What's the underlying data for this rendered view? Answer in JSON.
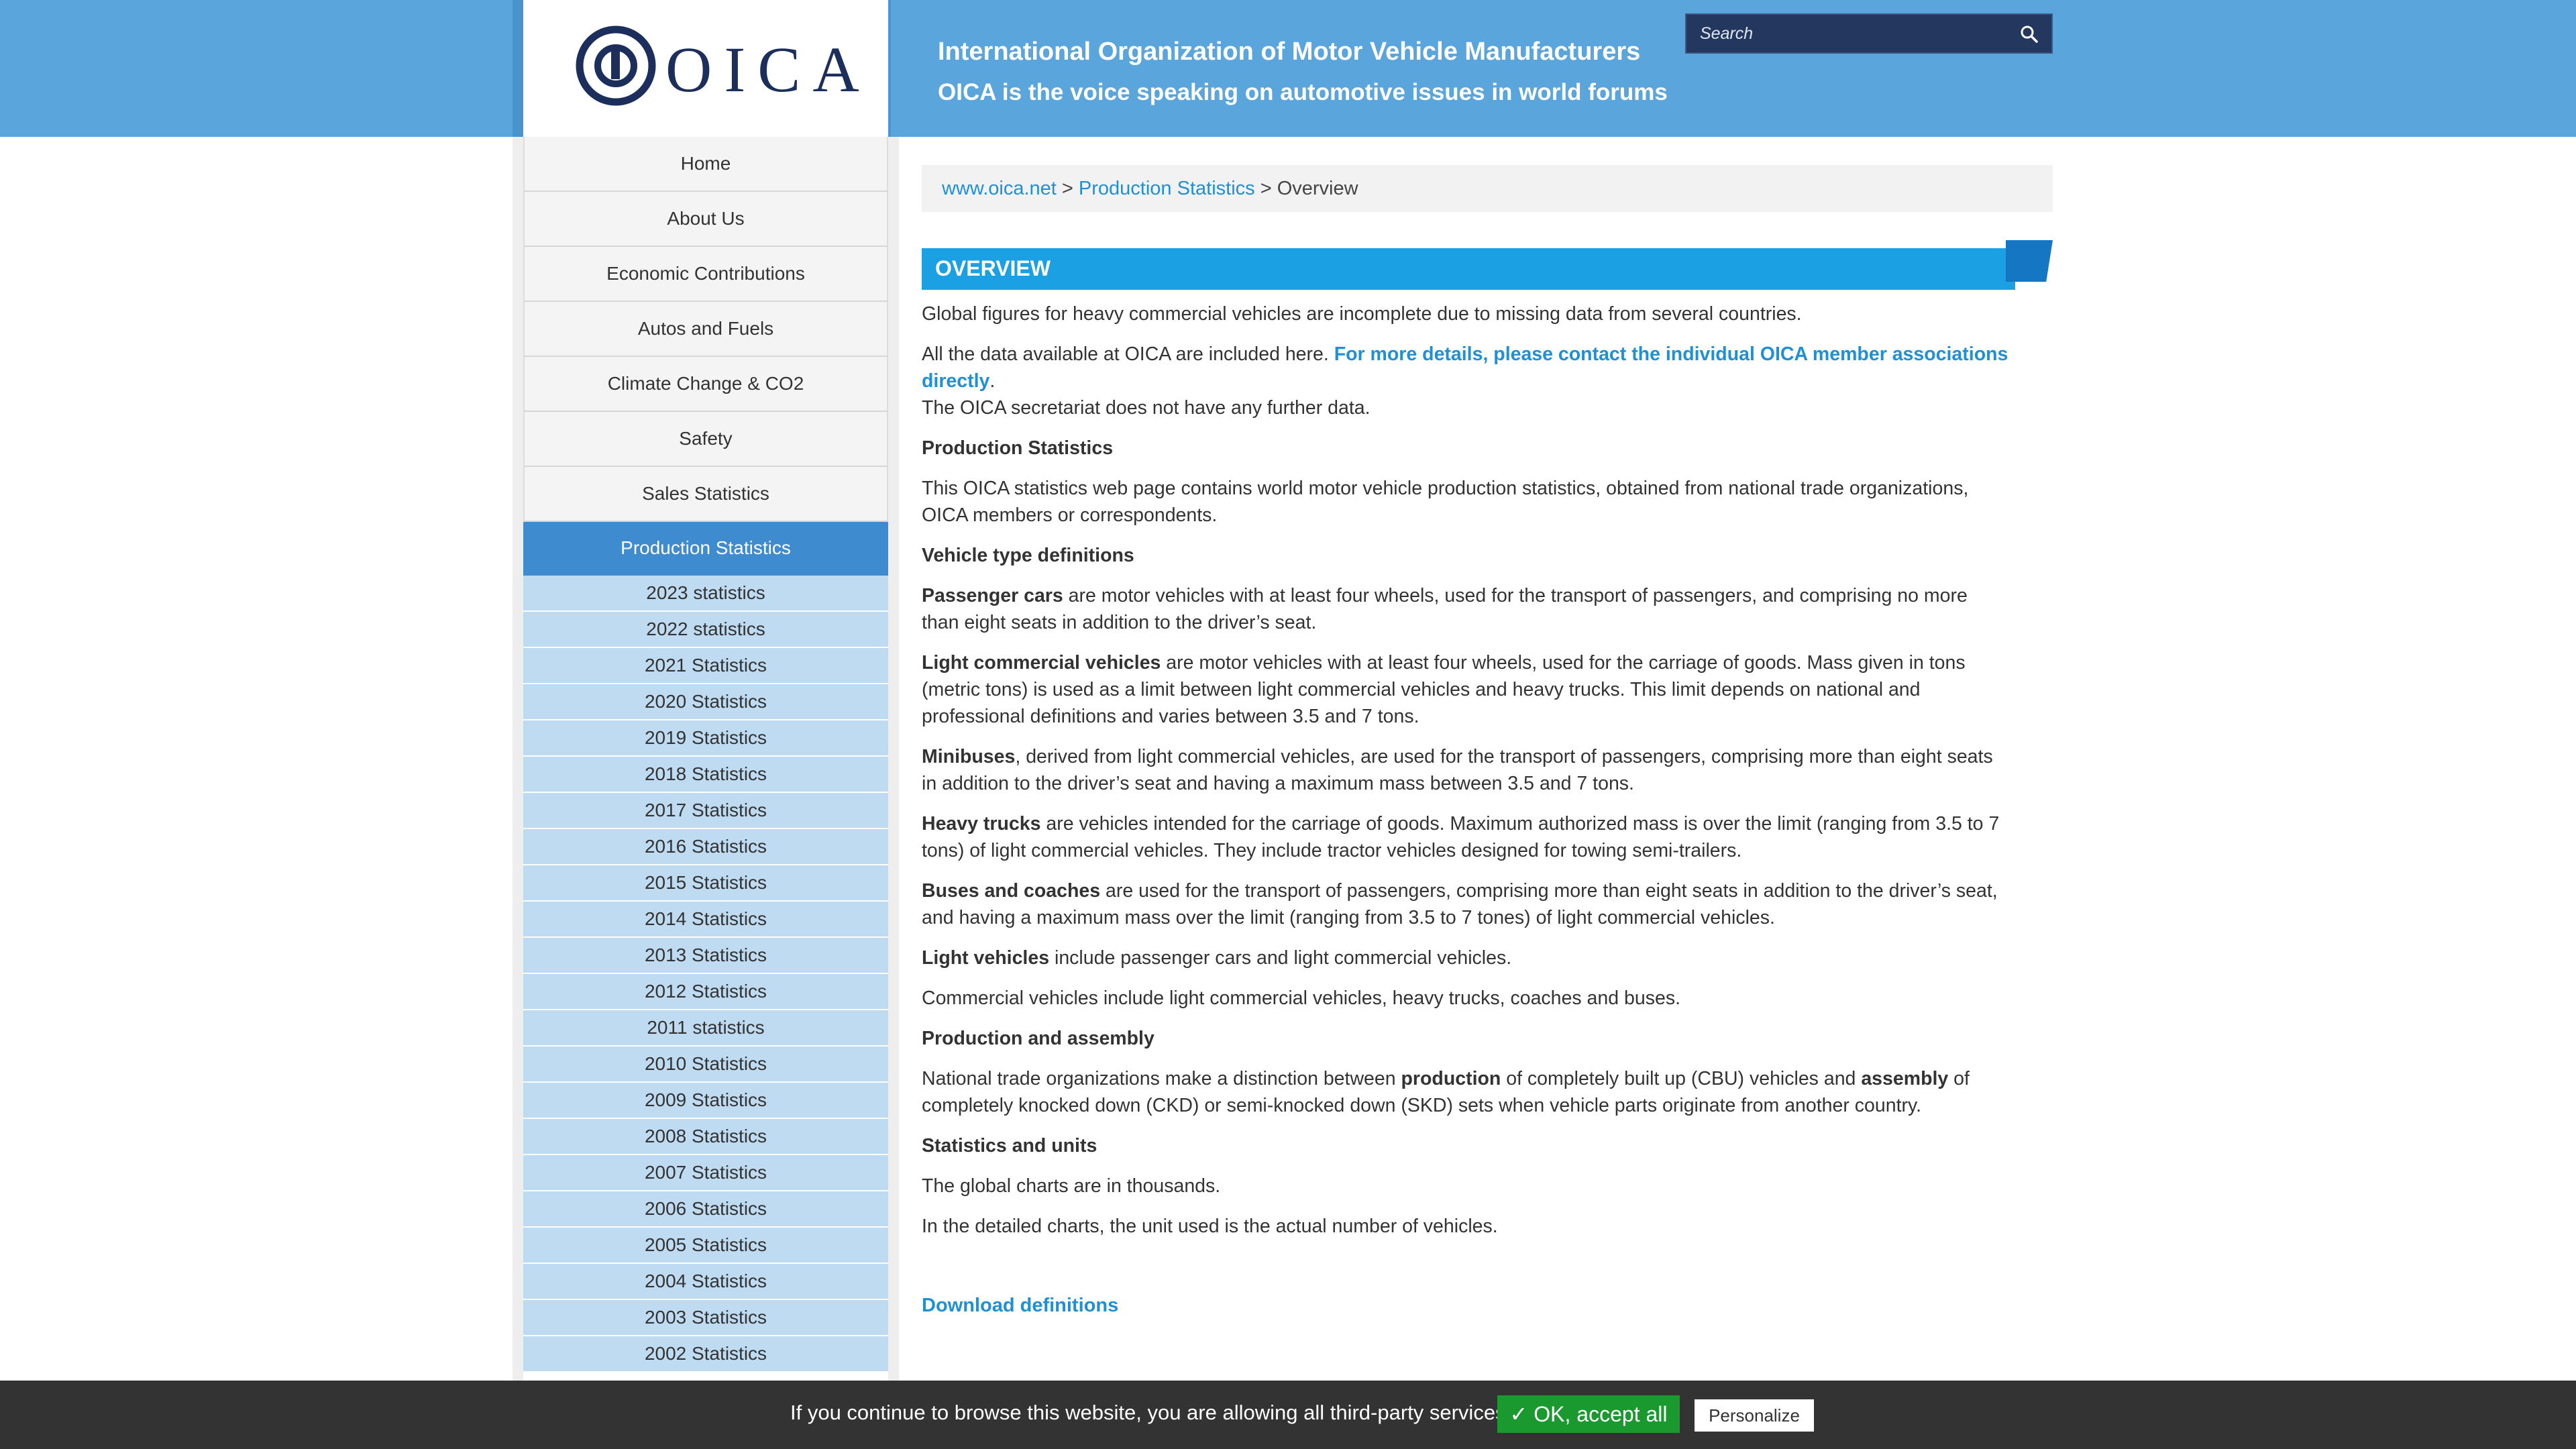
{
  "header": {
    "logo_text": "OICA",
    "title": "International Organization of Motor Vehicle Manufacturers",
    "subtitle": "OICA is the voice speaking on automotive issues in world forums",
    "search_placeholder": "Search",
    "colors": {
      "bar": "#5aa5dc",
      "logo": "#1c2e5c",
      "search_bg": "#24385f"
    }
  },
  "nav": {
    "items": [
      {
        "label": "Home"
      },
      {
        "label": "About Us"
      },
      {
        "label": "Economic Contributions"
      },
      {
        "label": "Autos and Fuels"
      },
      {
        "label": "Climate Change & CO2"
      },
      {
        "label": "Safety"
      },
      {
        "label": "Sales Statistics"
      },
      {
        "label": "Production Statistics",
        "active": true
      }
    ],
    "subitems": [
      "2023 statistics",
      "2022 statistics",
      "2021 Statistics",
      "2020 Statistics",
      "2019 Statistics",
      "2018 Statistics",
      "2017 Statistics",
      "2016 Statistics",
      "2015 Statistics",
      "2014 Statistics",
      "2013 Statistics",
      "2012 Statistics",
      "2011 statistics",
      "2010 Statistics",
      "2009 Statistics",
      "2008 Statistics",
      "2007 Statistics",
      "2006 Statistics",
      "2005 Statistics",
      "2004 Statistics",
      "2003 Statistics",
      "2002 Statistics"
    ]
  },
  "breadcrumb": {
    "home": "www.oica.net",
    "sep1": ">",
    "section": "Production Statistics",
    "sep2": ">",
    "current": "Overview"
  },
  "overview": {
    "heading": "OVERVIEW",
    "p1": "Global figures for heavy commercial vehicles are incomplete due to missing data from several countries.",
    "p2a": "All the data available at OICA are included here.",
    "p2_link": "For more details, please contact the individual OICA member associations directly",
    "p2_period": ".",
    "p2b": "The OICA secretariat does not have any further data.",
    "h_prod": "Production Statistics",
    "p_prod": "This OICA statistics web page contains world motor vehicle production statistics, obtained from national trade organizations, OICA members or correspondents.",
    "h_vtd": "Vehicle type definitions",
    "pc_term": "Passenger cars",
    "pc_text": " are motor vehicles with at least four wheels, used for the transport of passengers, and comprising no more than eight seats in addition to the driver’s seat.",
    "lcv_term": "Light commercial vehicles",
    "lcv_text": " are motor vehicles with at least four wheels, used for the carriage of goods. Mass given in tons (metric tons) is used as a limit between light commercial vehicles and heavy trucks. This limit depends on national and professional definitions and varies between 3.5 and 7 tons.",
    "mini_term": "Minibuses",
    "mini_text": ", derived from light commercial vehicles, are used for the transport of passengers, comprising more than eight seats in addition to the driver’s seat and having a maximum mass between 3.5 and 7 tons.",
    "ht_term": "Heavy trucks",
    "ht_text": " are vehicles intended for the carriage of goods. Maximum authorized mass is over the limit (ranging from 3.5 to 7 tons) of light commercial vehicles. They include tractor vehicles designed for towing semi-trailers.",
    "bc_term": "Buses and coaches",
    "bc_text": " are used for the transport of passengers, comprising more than eight seats in addition to the driver’s seat, and having a maximum mass over the limit (ranging from 3.5 to 7 tones) of light commercial vehicles.",
    "lv_term": "Light vehicles",
    "lv_text": " include passenger cars and light commercial vehicles.",
    "cv_text": "Commercial vehicles include light commercial vehicles, heavy trucks, coaches and buses.",
    "h_pa": "Production and assembly",
    "pa_1": "National trade organizations make a distinction between ",
    "pa_prod": "production",
    "pa_2": " of completely built up (CBU) vehicles and ",
    "pa_asm": "assembly",
    "pa_3": " of completely knocked down (CKD) or semi-knocked down (SKD) sets when vehicle parts originate from another country.",
    "h_su": "Statistics and units",
    "su_1": "The global charts are in thousands.",
    "su_2": "In the detailed charts, the unit used is the actual number of vehicles.",
    "download": "Download definitions"
  },
  "cookie": {
    "text": "If you continue to browse this website, you are allowing all third-party services",
    "accept": "✓ OK, accept all",
    "personalize": "Personalize"
  }
}
